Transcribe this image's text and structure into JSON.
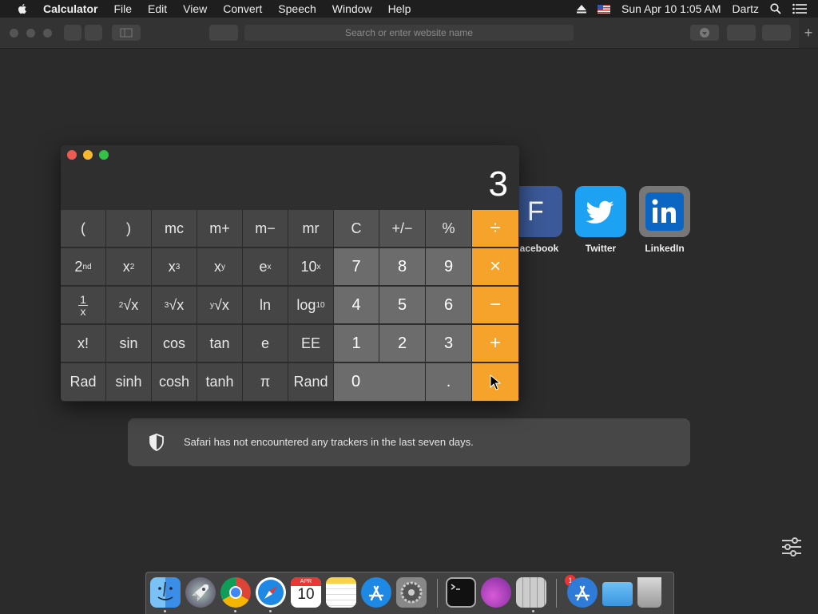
{
  "menubar": {
    "app_name": "Calculator",
    "items": [
      "File",
      "Edit",
      "View",
      "Convert",
      "Speech",
      "Window",
      "Help"
    ],
    "datetime": "Sun Apr 10  1:05 AM",
    "user": "Dartz"
  },
  "safari": {
    "address_placeholder": "Search or enter website name",
    "new_tab": "+"
  },
  "favorites": [
    {
      "label": "acebook",
      "letter": "F",
      "color": "#3b5998"
    },
    {
      "label": "Twitter",
      "color": "#1da1f2"
    },
    {
      "label": "LinkedIn",
      "color": "#0a66c2"
    }
  ],
  "privacy_report": {
    "text": "Safari has not encountered any trackers in the last seven days."
  },
  "calculator": {
    "display": "3",
    "keys": {
      "r1": [
        "(",
        ")",
        "mc",
        "m+",
        "m−",
        "mr",
        "C",
        "+/−",
        "%",
        "÷"
      ],
      "r2": [
        "2nd",
        "x2",
        "x3",
        "xy",
        "ex",
        "10x",
        "7",
        "8",
        "9",
        "×"
      ],
      "r3": [
        "1/x",
        "2√x",
        "3√x",
        "y√x",
        "ln",
        "log10",
        "4",
        "5",
        "6",
        "−"
      ],
      "r4": [
        "x!",
        "sin",
        "cos",
        "tan",
        "e",
        "EE",
        "1",
        "2",
        "3",
        "+"
      ],
      "r5": [
        "Rad",
        "sinh",
        "cosh",
        "tanh",
        "π",
        "Rand",
        "0",
        ".",
        "="
      ]
    }
  },
  "dock": {
    "calendar_month": "APR",
    "calendar_day": "10",
    "prefs_badge": "1"
  },
  "colors": {
    "operator": "#f5a32a",
    "number_key": "#6c6c6c",
    "scientific_key": "#454545"
  }
}
